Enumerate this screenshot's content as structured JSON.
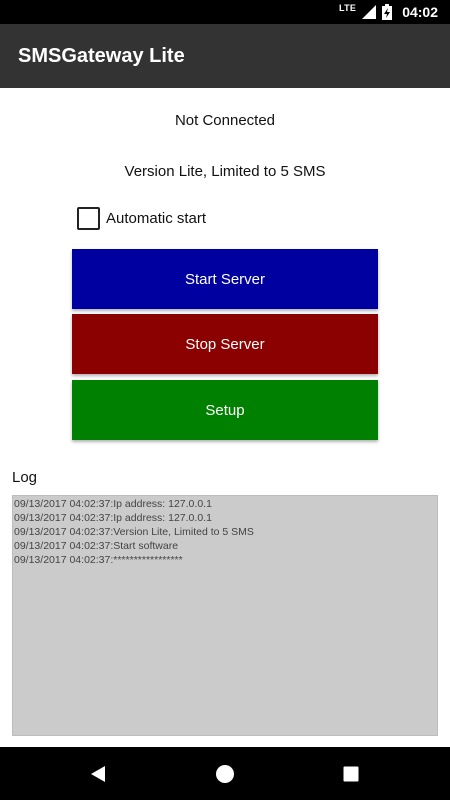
{
  "status_bar": {
    "network_type": "LTE",
    "time": "04:02",
    "icons": [
      "signal-icon",
      "battery-charging-icon"
    ]
  },
  "app_bar": {
    "title": "SMSGateway Lite"
  },
  "main": {
    "connection_status": "Not Connected",
    "version_info": "Version Lite, Limited to 5 SMS",
    "automatic_start": {
      "label": "Automatic start",
      "checked": false
    },
    "buttons": {
      "start_server": "Start Server",
      "stop_server": "Stop Server",
      "setup": "Setup"
    },
    "log": {
      "label": "Log",
      "lines": [
        "09/13/2017 04:02:37:Ip address: 127.0.0.1",
        "09/13/2017 04:02:37:Ip address: 127.0.0.1",
        "09/13/2017 04:02:37:Version Lite, Limited to 5 SMS",
        "09/13/2017 04:02:37:Start software",
        "09/13/2017 04:02:37:*****************"
      ]
    }
  },
  "nav_bar": {
    "icons": [
      "back-icon",
      "home-icon",
      "recents-icon"
    ]
  },
  "colors": {
    "start_button": "#0000a0",
    "stop_button": "#8b0000",
    "setup_button": "#008000",
    "app_bar": "#333333",
    "log_background": "#cbcbcb"
  }
}
